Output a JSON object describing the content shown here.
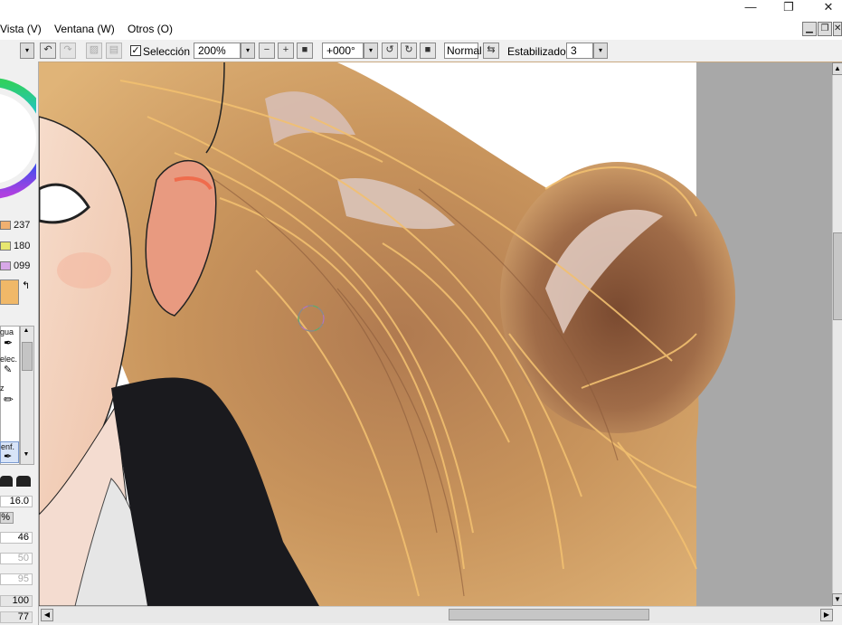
{
  "menu": [
    {
      "label": "Vista (V)"
    },
    {
      "label": "Ventana (W)"
    },
    {
      "label": "Otros (O)"
    }
  ],
  "window_controls": {
    "minimize_glyph": "—",
    "restore_glyph": "❐",
    "close_glyph": "✕"
  },
  "toolbar": {
    "selection_checked": true,
    "selection_label": "Selección",
    "zoom_value": "200%",
    "rotation_value": "+000°",
    "blend_mode_label": "Normal",
    "stabilizer_label": "Estabilizador",
    "stabilizer_value": "3"
  },
  "left_panel": {
    "color_values": [
      {
        "value": "237",
        "swatch": "#f0b070"
      },
      {
        "value": "180",
        "swatch": "#e8e870"
      },
      {
        "value": "099",
        "swatch": "#d8a8e8"
      }
    ],
    "primary_color": "#f0b868",
    "tool_labels": [
      "gua",
      "elec.",
      "z",
      "enf."
    ],
    "brush_size_value": "16.0",
    "opacity_value": "%",
    "param_values": [
      "46",
      "50",
      "95"
    ],
    "density_value": "100",
    "bottom_value": "77"
  },
  "icons": {
    "dropdown": "▾",
    "scroll_up": "▲",
    "scroll_down": "▼",
    "scroll_left": "◀",
    "scroll_right": "▶"
  },
  "colors": {
    "accent_border": "#c8a880",
    "canvas_gray": "#a8a8a8",
    "hair_light": "#f2c070",
    "hair_dark": "#8a5a3a"
  }
}
